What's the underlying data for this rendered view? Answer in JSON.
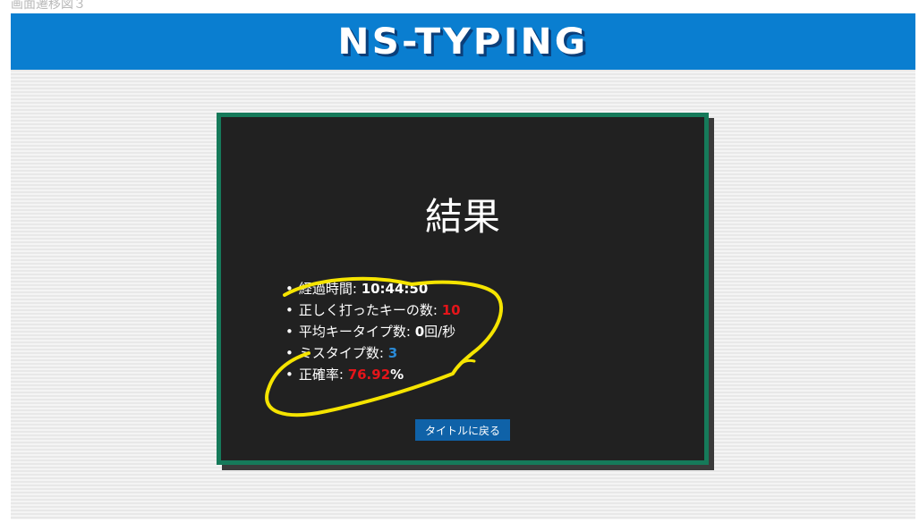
{
  "caption": "画面遷移図３",
  "header": {
    "logo_text": "NS-TYPING",
    "bg_color": "#0a7ed0"
  },
  "result": {
    "title": "結果",
    "stats": [
      {
        "label": "経過時間: ",
        "value": "10:44:50",
        "suffix": ""
      },
      {
        "label": "正しく打ったキーの数: ",
        "value": "10",
        "suffix": ""
      },
      {
        "label": "平均キータイプ数: ",
        "value": "0",
        "suffix": "回/秒"
      },
      {
        "label": "ミスタイプ数: ",
        "value": "3",
        "suffix": ""
      },
      {
        "label": "正確率: ",
        "value": "76.92",
        "suffix": "%"
      }
    ],
    "back_button_label": "タイトルに戻る"
  },
  "colors": {
    "panel_bg": "#212121",
    "panel_border": "#167a5a",
    "accent_red": "#e4151a",
    "accent_blue": "#2a8ad6",
    "button_bg": "#0f62a8",
    "annotation_yellow": "#f5e400"
  }
}
